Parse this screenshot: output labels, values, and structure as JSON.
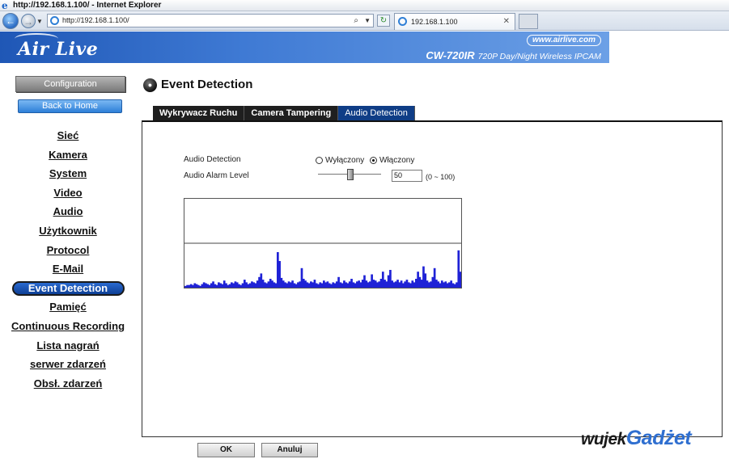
{
  "browser": {
    "title": "http://192.168.1.100/ - Internet Explorer",
    "address": "http://192.168.1.100/",
    "tab_title": "192.168.1.100"
  },
  "header": {
    "brand": "Air Live",
    "website": "www.airlive.com",
    "model": "CW-720IR",
    "model_desc": "720P Day/Night Wireless IPCAM"
  },
  "sidebar": {
    "configuration": "Configuration",
    "back_home": "Back to Home",
    "menu": [
      {
        "label": "Sieć"
      },
      {
        "label": "Kamera"
      },
      {
        "label": "System"
      },
      {
        "label": "Video"
      },
      {
        "label": "Audio"
      },
      {
        "label": "Użytkownik"
      },
      {
        "label": "Protocol"
      },
      {
        "label": "E-Mail"
      },
      {
        "label": "Event Detection",
        "active": true
      },
      {
        "label": "Pamięć"
      },
      {
        "label": "Continuous Recording"
      },
      {
        "label": "Lista nagrań"
      },
      {
        "label": "serwer zdarzeń"
      },
      {
        "label": "Obsł. zdarzeń"
      }
    ]
  },
  "main": {
    "title": "Event Detection",
    "tabs": [
      "Wykrywacz Ruchu",
      "Camera Tampering",
      "Audio Detection"
    ],
    "active_tab": "Audio Detection",
    "audio_detection_label": "Audio Detection",
    "option_off": "Wyłączony",
    "option_on": "Włączony",
    "selected": "Włączony",
    "alarm_level_label": "Audio Alarm Level",
    "alarm_level_value": "50",
    "alarm_level_range": "(0 ~ 100)",
    "audio_levels": [
      2,
      3,
      3,
      4,
      3,
      5,
      4,
      3,
      2,
      4,
      6,
      5,
      4,
      3,
      5,
      7,
      4,
      3,
      6,
      5,
      4,
      8,
      5,
      3,
      4,
      6,
      5,
      7,
      6,
      4,
      3,
      5,
      9,
      6,
      4,
      5,
      7,
      6,
      5,
      8,
      12,
      16,
      9,
      6,
      5,
      7,
      10,
      8,
      6,
      5,
      40,
      30,
      11,
      8,
      6,
      5,
      7,
      6,
      8,
      5,
      4,
      6,
      7,
      22,
      10,
      8,
      6,
      5,
      7,
      6,
      9,
      5,
      4,
      6,
      5,
      8,
      6,
      7,
      5,
      4,
      6,
      5,
      7,
      12,
      6,
      5,
      8,
      6,
      5,
      7,
      10,
      6,
      5,
      7,
      8,
      6,
      9,
      14,
      8,
      6,
      7,
      15,
      9,
      8,
      6,
      7,
      10,
      18,
      9,
      7,
      14,
      20,
      8,
      6,
      7,
      9,
      6,
      8,
      5,
      7,
      9,
      6,
      5,
      8,
      6,
      10,
      18,
      12,
      9,
      24,
      16,
      8,
      6,
      7,
      12,
      22,
      9,
      7,
      5,
      8,
      6,
      7,
      5,
      6,
      8,
      5,
      4,
      6,
      42,
      18
    ]
  },
  "footer": {
    "ok": "OK",
    "cancel": "Anuluj",
    "watermark_a": "wujek",
    "watermark_b": "Gadżet"
  }
}
